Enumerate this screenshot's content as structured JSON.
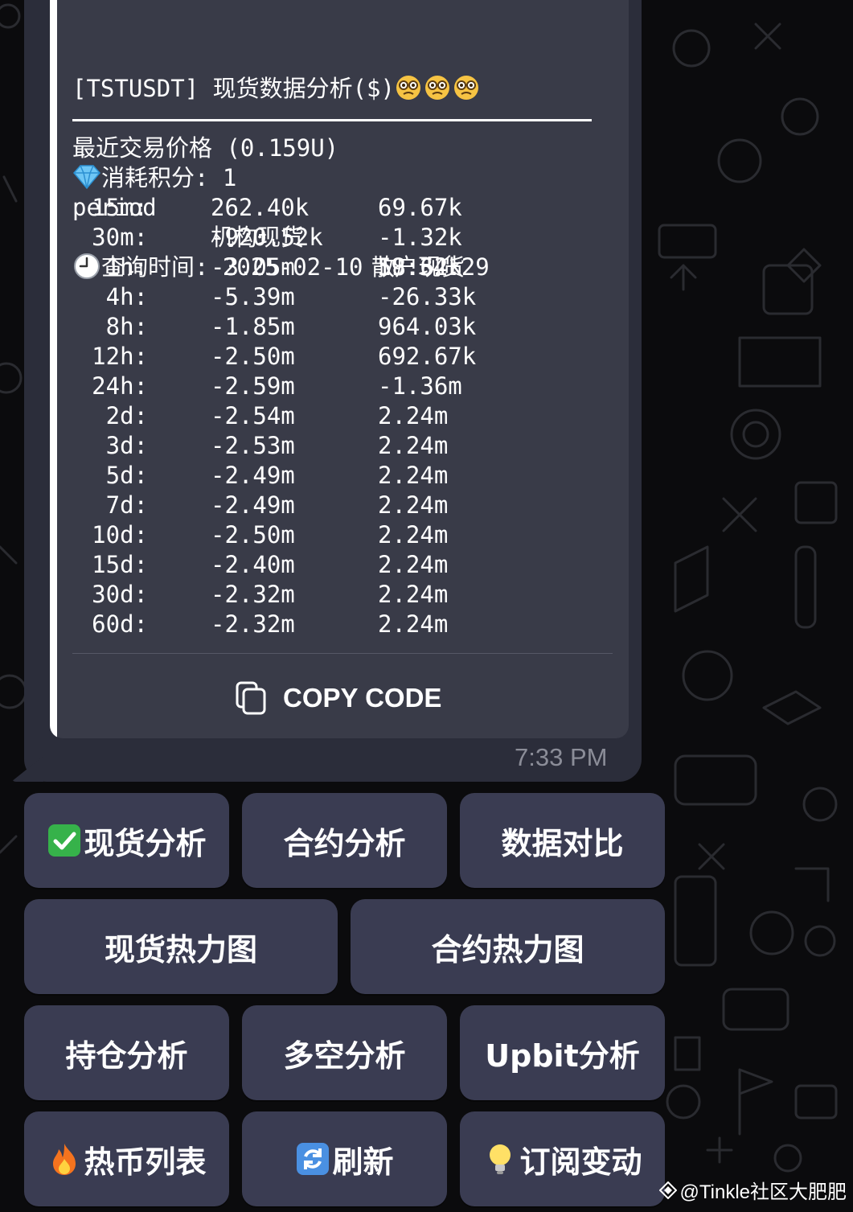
{
  "header": {
    "line1": "[TSTUSDT] 现货数据分析($)",
    "cost_label": "消耗积分: 1",
    "query_time_label": "查询时间: 2025-02-10 19:34:29"
  },
  "table": {
    "title": "最近交易价格 (0.159U)",
    "columns": [
      "period",
      "机构现货",
      "散户现货"
    ],
    "rows": [
      {
        "period": "15m:",
        "inst": "262.40k",
        "retail": "69.67k"
      },
      {
        "period": "30m:",
        "inst": "-920.52k",
        "retail": "-1.32k"
      },
      {
        "period": "1h:",
        "inst": "-3.05m",
        "retail": "58.62k"
      },
      {
        "period": "4h:",
        "inst": "-5.39m",
        "retail": "-26.33k"
      },
      {
        "period": "8h:",
        "inst": "-1.85m",
        "retail": "964.03k"
      },
      {
        "period": "12h:",
        "inst": "-2.50m",
        "retail": "692.67k"
      },
      {
        "period": "24h:",
        "inst": "-2.59m",
        "retail": "-1.36m"
      },
      {
        "period": "2d:",
        "inst": "-2.54m",
        "retail": "2.24m"
      },
      {
        "period": "3d:",
        "inst": "-2.53m",
        "retail": "2.24m"
      },
      {
        "period": "5d:",
        "inst": "-2.49m",
        "retail": "2.24m"
      },
      {
        "period": "7d:",
        "inst": "-2.49m",
        "retail": "2.24m"
      },
      {
        "period": "10d:",
        "inst": "-2.50m",
        "retail": "2.24m"
      },
      {
        "period": "15d:",
        "inst": "-2.40m",
        "retail": "2.24m"
      },
      {
        "period": "30d:",
        "inst": "-2.32m",
        "retail": "2.24m"
      },
      {
        "period": "60d:",
        "inst": "-2.32m",
        "retail": "2.24m"
      }
    ]
  },
  "copy_code_label": "COPY CODE",
  "message_time": "7:33 PM",
  "buttons": {
    "spot_analysis": "现货分析",
    "contract_analysis": "合约分析",
    "data_compare": "数据对比",
    "spot_heatmap": "现货热力图",
    "contract_heatmap": "合约热力图",
    "position_analysis": "持仓分析",
    "long_short_analysis": "多空分析",
    "upbit_analysis": "Upbit分析",
    "hot_coins": "热币列表",
    "refresh": "刷新",
    "subscribe": "订阅变动"
  },
  "watermark": "@Tinkle社区大肥肥",
  "colors": {
    "background": "#0b0b0d",
    "bubble": "#2b2d3a",
    "code_block": "#393b48",
    "keyboard_button": "#3a3c52",
    "time_text": "#8b8d98"
  }
}
